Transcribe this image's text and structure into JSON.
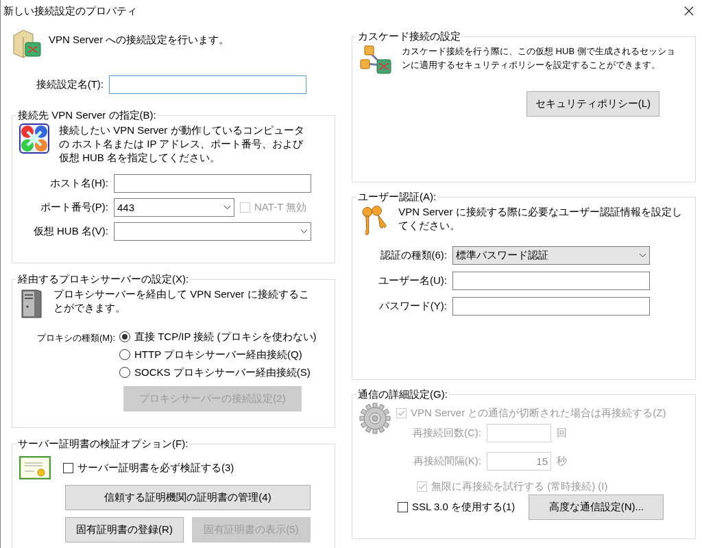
{
  "window": {
    "title": "新しい接続設定のプロパティ"
  },
  "header": {
    "text": "VPN Server への接続設定を行います。"
  },
  "connection_name": {
    "label": "接続設定名(T):",
    "focused": true
  },
  "server_group": {
    "title": "接続先 VPN Server の指定(B):",
    "description": "接続したい VPN Server が動作しているコンピュータの ホスト名または IP アドレス、ポート番号、および仮想 HUB 名を指定してください。",
    "fields": [
      {
        "kind": "text",
        "label": "ホスト名(H):"
      },
      {
        "kind": "combo",
        "label": "ポート番号(P):",
        "value": "443",
        "option": {
          "label": "NAT-T 無効",
          "checked": false,
          "disabled": true
        }
      },
      {
        "kind": "combo",
        "label": "仮想 HUB 名(V):"
      }
    ]
  },
  "proxy_group": {
    "title": "経由するプロキシサーバーの設定(X):",
    "description": "プロキシサーバーを経由して VPN Server に接続することができます。",
    "type_label": "プロキシの種類(M):",
    "options": [
      {
        "label": "直接 TCP/IP 接続 (プロキシを使わない)",
        "selected": true
      },
      {
        "label": "HTTP プロキシサーバー経由接続(Q)",
        "selected": false
      },
      {
        "label": "SOCKS プロキシサーバー経由接続(S)",
        "selected": false
      }
    ],
    "settings_button": {
      "label": "プロキシサーバーの接続設定(2)",
      "disabled": true
    }
  },
  "cert_group": {
    "title": "サーバー証明書の検証オプション(F):",
    "verify": {
      "label": "サーバー証明書を必ず検証する(3)",
      "checked": false
    },
    "buttons": [
      {
        "label": "信頼する証明機関の証明書の管理(4)",
        "disabled": false
      },
      {
        "label": "固有証明書の登録(R)",
        "disabled": false
      },
      {
        "label": "固有証明書の表示(5)",
        "disabled": true
      }
    ]
  },
  "cascade_group": {
    "title": "カスケード接続の設定",
    "description": "カスケード接続を行う際に、この仮想 HUB 側で生成されるセッションに適用するセキュリティポリシーを設定することができます。",
    "button": {
      "label": "セキュリティポリシー(L)"
    }
  },
  "auth_group": {
    "title": "ユーザー認証(A):",
    "description": "VPN Server に接続する際に必要なユーザー認証情報を設定してください。",
    "fields": [
      {
        "kind": "select",
        "label": "認証の種類(6):",
        "value": "標準パスワード認証"
      },
      {
        "kind": "text",
        "label": "ユーザー名(U):"
      },
      {
        "kind": "text",
        "label": "パスワード(Y):"
      }
    ]
  },
  "advanced_group": {
    "title": "通信の詳細設定(G):",
    "reconnect": {
      "label": "VPN Server との通信が切断された場合は再接続する(Z)",
      "checked": true,
      "disabled": true
    },
    "fields": [
      {
        "label": "再接続回数(C):",
        "unit": "回",
        "disabled": true
      },
      {
        "label": "再接続間隔(K):",
        "value": "15",
        "unit": "秒",
        "disabled": true
      }
    ],
    "infinite": {
      "label": "無限に再接続を試行する (常時接続) (I)",
      "checked": true,
      "disabled": true
    },
    "ssl": {
      "label": "SSL 3.0 を使用する(1)",
      "checked": false
    },
    "button": {
      "label": "高度な通信設定(N)..."
    }
  }
}
